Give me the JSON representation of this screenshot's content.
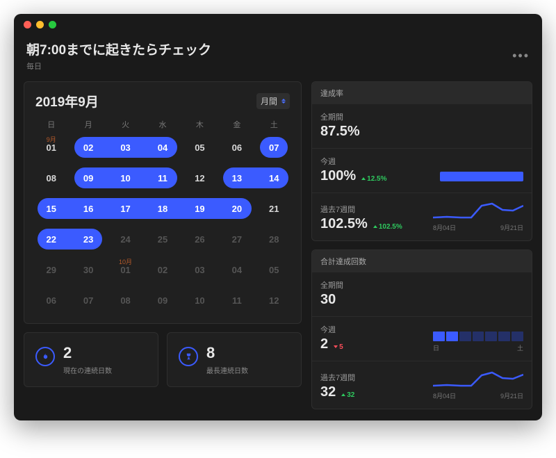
{
  "header": {
    "title": "朝7:00までに起きたらチェック",
    "subtitle": "毎日",
    "more": "•••"
  },
  "calendar": {
    "title": "2019年9月",
    "range_selector": "月間",
    "dow": [
      "日",
      "月",
      "火",
      "水",
      "木",
      "金",
      "土"
    ],
    "month_label_prev": "9月",
    "month_label_next": "10月",
    "cells": [
      {
        "n": "01",
        "in": true,
        "ml": "9月"
      },
      {
        "n": "02",
        "in": true
      },
      {
        "n": "03",
        "in": true
      },
      {
        "n": "04",
        "in": true
      },
      {
        "n": "05",
        "in": true
      },
      {
        "n": "06",
        "in": true
      },
      {
        "n": "07",
        "in": true
      },
      {
        "n": "08",
        "in": true
      },
      {
        "n": "09",
        "in": true
      },
      {
        "n": "10",
        "in": true
      },
      {
        "n": "11",
        "in": true
      },
      {
        "n": "12",
        "in": true
      },
      {
        "n": "13",
        "in": true
      },
      {
        "n": "14",
        "in": true
      },
      {
        "n": "15",
        "in": true
      },
      {
        "n": "16",
        "in": true
      },
      {
        "n": "17",
        "in": true
      },
      {
        "n": "18",
        "in": true
      },
      {
        "n": "19",
        "in": true
      },
      {
        "n": "20",
        "in": true
      },
      {
        "n": "21",
        "in": true
      },
      {
        "n": "22",
        "in": true
      },
      {
        "n": "23",
        "in": true
      },
      {
        "n": "24",
        "in": false
      },
      {
        "n": "25",
        "in": false
      },
      {
        "n": "26",
        "in": false
      },
      {
        "n": "27",
        "in": false
      },
      {
        "n": "28",
        "in": false
      },
      {
        "n": "29",
        "in": false
      },
      {
        "n": "30",
        "in": false
      },
      {
        "n": "01",
        "in": false,
        "ml": "10月"
      },
      {
        "n": "02",
        "in": false
      },
      {
        "n": "03",
        "in": false
      },
      {
        "n": "04",
        "in": false
      },
      {
        "n": "05",
        "in": false
      },
      {
        "n": "06",
        "in": false
      },
      {
        "n": "07",
        "in": false
      },
      {
        "n": "08",
        "in": false
      },
      {
        "n": "09",
        "in": false
      },
      {
        "n": "10",
        "in": false
      },
      {
        "n": "11",
        "in": false
      },
      {
        "n": "12",
        "in": false
      }
    ],
    "streak_pills": [
      {
        "row": 0,
        "start": 1,
        "end": 3
      },
      {
        "row": 0,
        "start": 6,
        "end": 6
      },
      {
        "row": 1,
        "start": 1,
        "end": 3
      },
      {
        "row": 1,
        "start": 5,
        "end": 6
      },
      {
        "row": 2,
        "start": 0,
        "end": 5
      },
      {
        "row": 3,
        "start": 0,
        "end": 1
      }
    ]
  },
  "streaks": {
    "current": {
      "value": "2",
      "label": "現在の連続日数"
    },
    "longest": {
      "value": "8",
      "label": "最長連続日数"
    }
  },
  "rate": {
    "section_title": "達成率",
    "all": {
      "label": "全期間",
      "value": "87.5%"
    },
    "week": {
      "label": "今週",
      "value": "100%",
      "delta": "12.5%",
      "dir": "up"
    },
    "seven": {
      "label": "過去7週間",
      "value": "102.5%",
      "delta": "102.5%",
      "dir": "up",
      "axis_start": "8月04日",
      "axis_end": "9月21日"
    }
  },
  "count": {
    "section_title": "合計達成回数",
    "all": {
      "label": "全期間",
      "value": "30"
    },
    "week": {
      "label": "今週",
      "value": "2",
      "delta": "5",
      "dir": "down",
      "days": [
        true,
        true,
        false,
        false,
        false,
        false,
        false
      ],
      "dl_start": "日",
      "dl_end": "土"
    },
    "seven": {
      "label": "過去7週間",
      "value": "32",
      "delta": "32",
      "dir": "up",
      "axis_start": "8月04日",
      "axis_end": "9月21日"
    }
  },
  "colors": {
    "accent": "#3b5bff"
  }
}
